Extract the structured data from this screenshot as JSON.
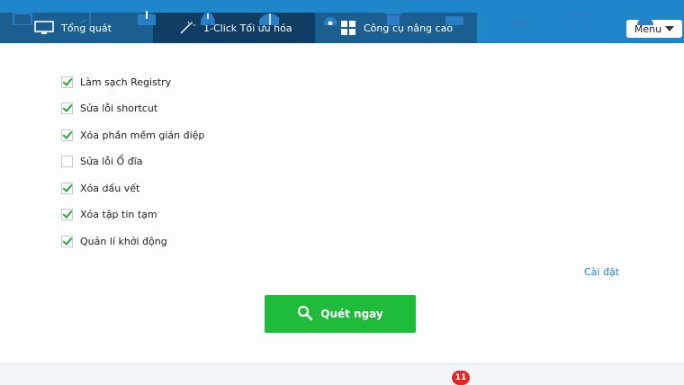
{
  "tabs": [
    {
      "label": "Tổng quát",
      "icon": "monitor-icon"
    },
    {
      "label": "1-Click Tối ưu hóa",
      "icon": "magic-wand-icon"
    },
    {
      "label": "Công cụ nâng cao",
      "icon": "grid-icon"
    }
  ],
  "menu": {
    "label": "Menu"
  },
  "options": [
    {
      "label": "Làm sạch Registry",
      "checked": true
    },
    {
      "label": "Sửa lỗi shortcut",
      "checked": true
    },
    {
      "label": "Xóa phần mềm gián điệp",
      "checked": true
    },
    {
      "label": "Sửa lỗi Ổ đĩa",
      "checked": false
    },
    {
      "label": "Xóa dấu vết",
      "checked": true
    },
    {
      "label": "Xóa tập tin tạm",
      "checked": true
    },
    {
      "label": "Quản lí khởi động",
      "checked": true
    }
  ],
  "settings": {
    "label": "Cài đặt"
  },
  "scan": {
    "label": "Quét ngay",
    "icon": "search-icon"
  },
  "bottom_badge": "11",
  "colors": {
    "header": "#1f87c9",
    "active_tab": "#0f3d63",
    "scan_button": "#1fbb3b",
    "checkmark": "#27a535",
    "badge": "#e02828"
  }
}
